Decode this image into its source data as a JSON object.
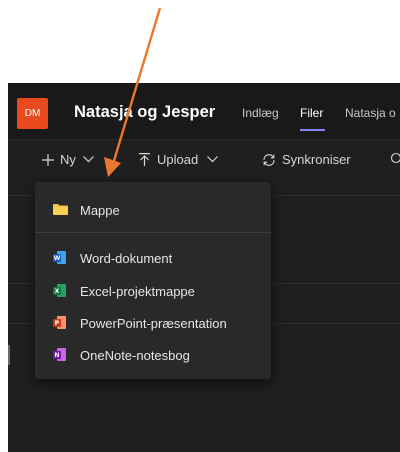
{
  "header": {
    "avatar_initials": "DM",
    "team_name": "Natasja og Jesper",
    "tabs": [
      {
        "label": "Indlæg"
      },
      {
        "label": "Filer"
      },
      {
        "label": "Natasja o"
      }
    ]
  },
  "toolbar": {
    "new_label": "Ny",
    "upload_label": "Upload",
    "sync_label": "Synkroniser"
  },
  "menu": {
    "items": [
      {
        "label": "Mappe",
        "icon": "folder-icon"
      },
      {
        "label": "Word-dokument",
        "icon": "word-icon"
      },
      {
        "label": "Excel-projektmappe",
        "icon": "excel-icon"
      },
      {
        "label": "PowerPoint-præsentation",
        "icon": "powerpoint-icon"
      },
      {
        "label": "OneNote-notesbog",
        "icon": "onenote-icon"
      }
    ]
  },
  "colors": {
    "accent": "#7f85f5",
    "avatar_bg": "#e8491d",
    "annotation_arrow": "#e8782a",
    "word": "#185abd",
    "excel": "#107c41",
    "powerpoint": "#c43e1c",
    "onenote": "#7719aa",
    "folder": "#f5c242"
  }
}
